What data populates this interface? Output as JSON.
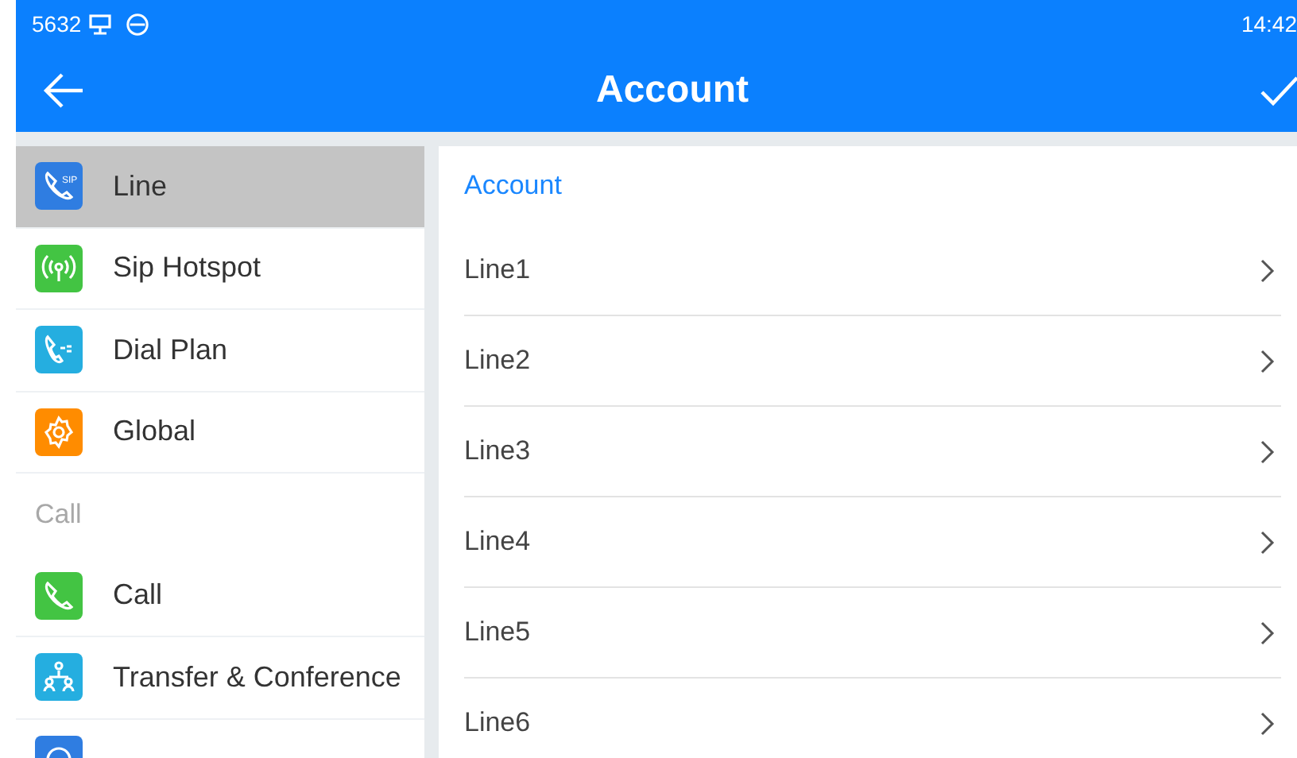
{
  "status_bar": {
    "extension": "5632",
    "time": "14:42"
  },
  "title_bar": {
    "title": "Account"
  },
  "sidebar": {
    "items": [
      {
        "kind": "item",
        "label": "Line",
        "icon_text": "SIP",
        "color": "#2f7de1",
        "selected": true
      },
      {
        "kind": "item",
        "label": "Sip Hotspot",
        "color": "#43c443",
        "selected": false
      },
      {
        "kind": "item",
        "label": "Dial Plan",
        "color": "#25aee0",
        "selected": false
      },
      {
        "kind": "item",
        "label": "Global",
        "color": "#ff8c00",
        "selected": false
      },
      {
        "kind": "header",
        "label": "Call"
      },
      {
        "kind": "item",
        "label": "Call",
        "color": "#43c443",
        "selected": false
      },
      {
        "kind": "item",
        "label": "Transfer & Conference",
        "color": "#25aee0",
        "selected": false
      },
      {
        "kind": "item",
        "color": "#2f7de1"
      }
    ]
  },
  "content": {
    "section_title": "Account",
    "rows": [
      {
        "label": "Line1"
      },
      {
        "label": "Line2"
      },
      {
        "label": "Line3"
      },
      {
        "label": "Line4"
      },
      {
        "label": "Line5"
      },
      {
        "label": "Line6"
      }
    ]
  }
}
